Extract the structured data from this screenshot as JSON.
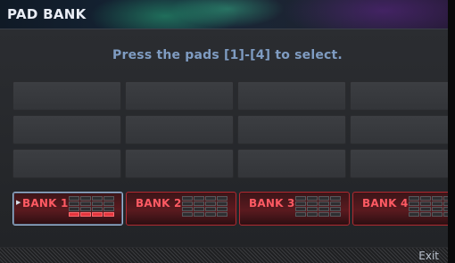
{
  "window": {
    "title": "PAD BANK"
  },
  "main": {
    "prompt": "Press the pads [1]-[4] to select.",
    "empty_rows": 3,
    "banks": [
      {
        "label": "BANK 1",
        "selected": true,
        "lit_row": 4
      },
      {
        "label": "BANK 2",
        "selected": false,
        "lit_row": null
      },
      {
        "label": "BANK 3",
        "selected": false,
        "lit_row": null
      },
      {
        "label": "BANK 4",
        "selected": false,
        "lit_row": null
      }
    ]
  },
  "footer": {
    "exit_label": "Exit"
  },
  "colors": {
    "bank_text": "#ff5a63",
    "prompt_text": "#7f9cc2",
    "lit_pad": "#e4353d"
  }
}
